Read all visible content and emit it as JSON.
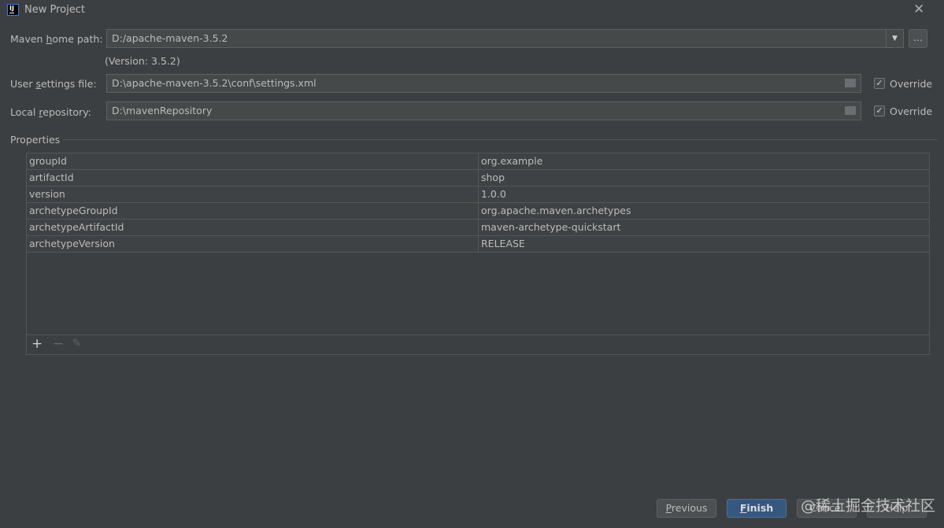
{
  "window": {
    "title": "New Project",
    "logo_text": "IJ"
  },
  "maven_home": {
    "label_pre": "Maven ",
    "label_u": "h",
    "label_post": "ome path:",
    "value": "D:/apache-maven-3.5.2",
    "version": "(Version: 3.5.2)",
    "browse": "..."
  },
  "user_settings": {
    "label_pre": "User ",
    "label_u": "s",
    "label_post": "ettings file:",
    "value": "D:\\apache-maven-3.5.2\\conf\\settings.xml",
    "override": "Override",
    "checked": true
  },
  "local_repo": {
    "label_pre": "Local ",
    "label_u": "r",
    "label_post": "epository:",
    "value": "D:\\mavenRepository",
    "override": "Override",
    "checked": true
  },
  "properties": {
    "title": "Properties",
    "rows": [
      {
        "key": "groupId",
        "value": "org.example"
      },
      {
        "key": "artifactId",
        "value": "shop"
      },
      {
        "key": "version",
        "value": "1.0.0"
      },
      {
        "key": "archetypeGroupId",
        "value": "org.apache.maven.archetypes"
      },
      {
        "key": "archetypeArtifactId",
        "value": "maven-archetype-quickstart"
      },
      {
        "key": "archetypeVersion",
        "value": "RELEASE"
      }
    ]
  },
  "buttons": {
    "previous_u": "P",
    "previous": "revious",
    "finish_u": "F",
    "finish": "inish",
    "cancel": "Cancel",
    "help": "Help"
  },
  "watermark": "@稀土掘金技术社区",
  "colors": {
    "accent": "#365880",
    "bg": "#3c3f41"
  }
}
